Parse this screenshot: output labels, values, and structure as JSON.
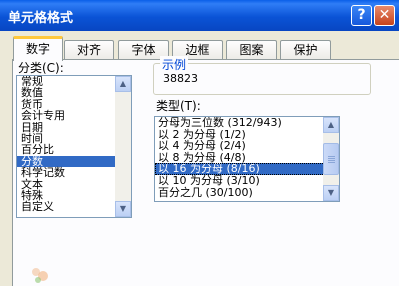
{
  "window": {
    "title": "单元格格式",
    "help_glyph": "?",
    "close_glyph": "✕"
  },
  "tabs": [
    {
      "label": "数字",
      "active": true
    },
    {
      "label": "对齐",
      "active": false
    },
    {
      "label": "字体",
      "active": false
    },
    {
      "label": "边框",
      "active": false
    },
    {
      "label": "图案",
      "active": false
    },
    {
      "label": "保护",
      "active": false
    }
  ],
  "category": {
    "label": "分类(C):",
    "items": [
      "常规",
      "数值",
      "货币",
      "会计专用",
      "日期",
      "时间",
      "百分比",
      "分数",
      "科学记数",
      "文本",
      "特殊",
      "自定义"
    ],
    "selected": "分数"
  },
  "sample": {
    "label": "示例",
    "value": "38823"
  },
  "type": {
    "label": "类型(T):",
    "items": [
      "分母为三位数 (312/943)",
      "以 2 为分母 (1/2)",
      "以 4 为分母 (2/4)",
      "以 8 为分母 (4/8)",
      "以 16 为分母 (8/16)",
      "以 10 为分母 (3/10)",
      "百分之几 (30/100)"
    ],
    "selected": "以 16 为分母 (8/16)"
  },
  "colors": {
    "titlebar": "#0a53d6",
    "selection": "#316ac5",
    "tab_highlight": "#ffc83c",
    "legend": "#0046d5"
  }
}
